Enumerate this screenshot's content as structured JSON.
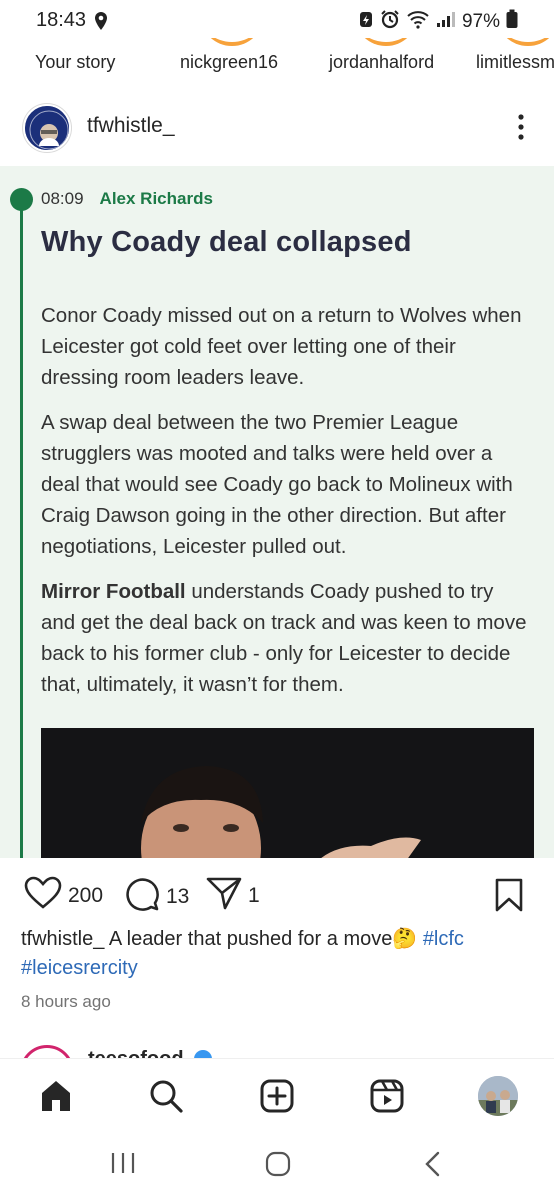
{
  "status_bar": {
    "time": "18:43",
    "battery": "97%"
  },
  "stories": [
    {
      "label": "Your story"
    },
    {
      "label": "nickgreen16"
    },
    {
      "label": "jordanhalford"
    },
    {
      "label": "limitlessm"
    }
  ],
  "post": {
    "username": "tfwhistle_",
    "article": {
      "time": "08:09",
      "author": "Alex Richards",
      "headline": "Why Coady deal collapsed",
      "paragraphs": [
        {
          "text": "Conor Coady missed out on a return to Wolves when Leicester got cold feet over letting one of their dressing room leaders leave."
        },
        {
          "text": "A swap deal between the two Premier League strugglers was mooted and talks were held over a deal that would see Coady go back to Molineux with Craig Dawson going in the other direction. But after negotiations, Leicester pulled out."
        },
        {
          "bold": "Mirror Football",
          "text": " understands Coady pushed to try and get the deal back on track and was keen to move back to his former club - only for Leicester to decide that, ultimately, it wasn’t for them."
        }
      ]
    },
    "likes": "200",
    "comments": "13",
    "shares": "1",
    "caption": {
      "username": "tfwhistle_",
      "text": " A leader that pushed for a move🤔 ",
      "hashtags": [
        "#lcfc",
        "#leicesrercity"
      ]
    },
    "timestamp": "8 hours ago"
  },
  "next_post": {
    "username": "teesofood"
  },
  "colors": {
    "accent_green": "#1c7a47",
    "headline": "#2b2d42",
    "hashtag": "#2e6ab7",
    "article_bg": "#eef5ef"
  },
  "icons": {
    "like": "heart-icon",
    "comment": "comment-icon",
    "share": "send-icon",
    "save": "bookmark-icon",
    "home": "home-icon",
    "search": "search-icon",
    "create": "plus-square-icon",
    "reels": "reels-icon"
  }
}
